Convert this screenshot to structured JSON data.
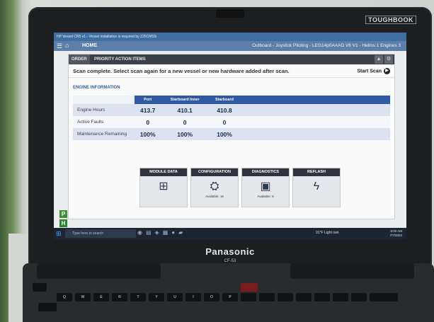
{
  "window": {
    "title": "HP Vessel CR5 v1 - Vessel installation is required by Z25CMSS",
    "home_label": "HOME",
    "header_title": "Outboard - Joystick Piloting - LEG14p0AAAD V6 V1 - Helms 1 Engines 3"
  },
  "tabs": [
    "ORDER",
    "PRIORITY ACTION ITEMS"
  ],
  "scan": {
    "message": "Scan complete. Select scan again for a new vessel or new hardware added after scan.",
    "button": "Start Scan"
  },
  "engine_info": {
    "section_title": "ENGINE INFORMATION",
    "columns": [
      "Port",
      "Starboard Inner",
      "Starboard"
    ],
    "rows": [
      {
        "label": "Engine Hours",
        "values": [
          "413.7",
          "410.1",
          "410.8"
        ]
      },
      {
        "label": "Active Faults",
        "values": [
          "0",
          "0",
          "0"
        ]
      },
      {
        "label": "Maintenance Remaining",
        "values": [
          "100%",
          "100%",
          "100%"
        ]
      }
    ]
  },
  "cards": [
    {
      "title": "MODULE DATA",
      "icon": "module-tree-icon",
      "sub": ""
    },
    {
      "title": "CONFIGURATION",
      "icon": "configuration-icon",
      "sub": "Available: 16"
    },
    {
      "title": "DIAGNOSTICS",
      "icon": "diagnostics-monitor-icon",
      "sub": "Available: 9"
    },
    {
      "title": "REFLASH",
      "icon": "lightning-icon",
      "sub": ""
    }
  ],
  "side_buttons": [
    "P",
    "H"
  ],
  "taskbar": {
    "search_placeholder": "Type here to search",
    "weather": "91°F Light rain",
    "time": "8:00 AM",
    "date": "7/7/2022"
  },
  "hardware": {
    "badge": "TOUGHBOOK",
    "logo": "Panasonic",
    "model": "CF-53"
  },
  "keyboard_row1": [
    "Q",
    "W",
    "E",
    "R",
    "T",
    "Y",
    "U",
    "I",
    "O",
    "P"
  ],
  "colors": {
    "accent_blue": "#2f5aa3",
    "titlebar": "#3f6fa1",
    "tab_dark": "#3b3f47",
    "side_p": "#3f8f3a",
    "side_h": "#2f7f34"
  }
}
